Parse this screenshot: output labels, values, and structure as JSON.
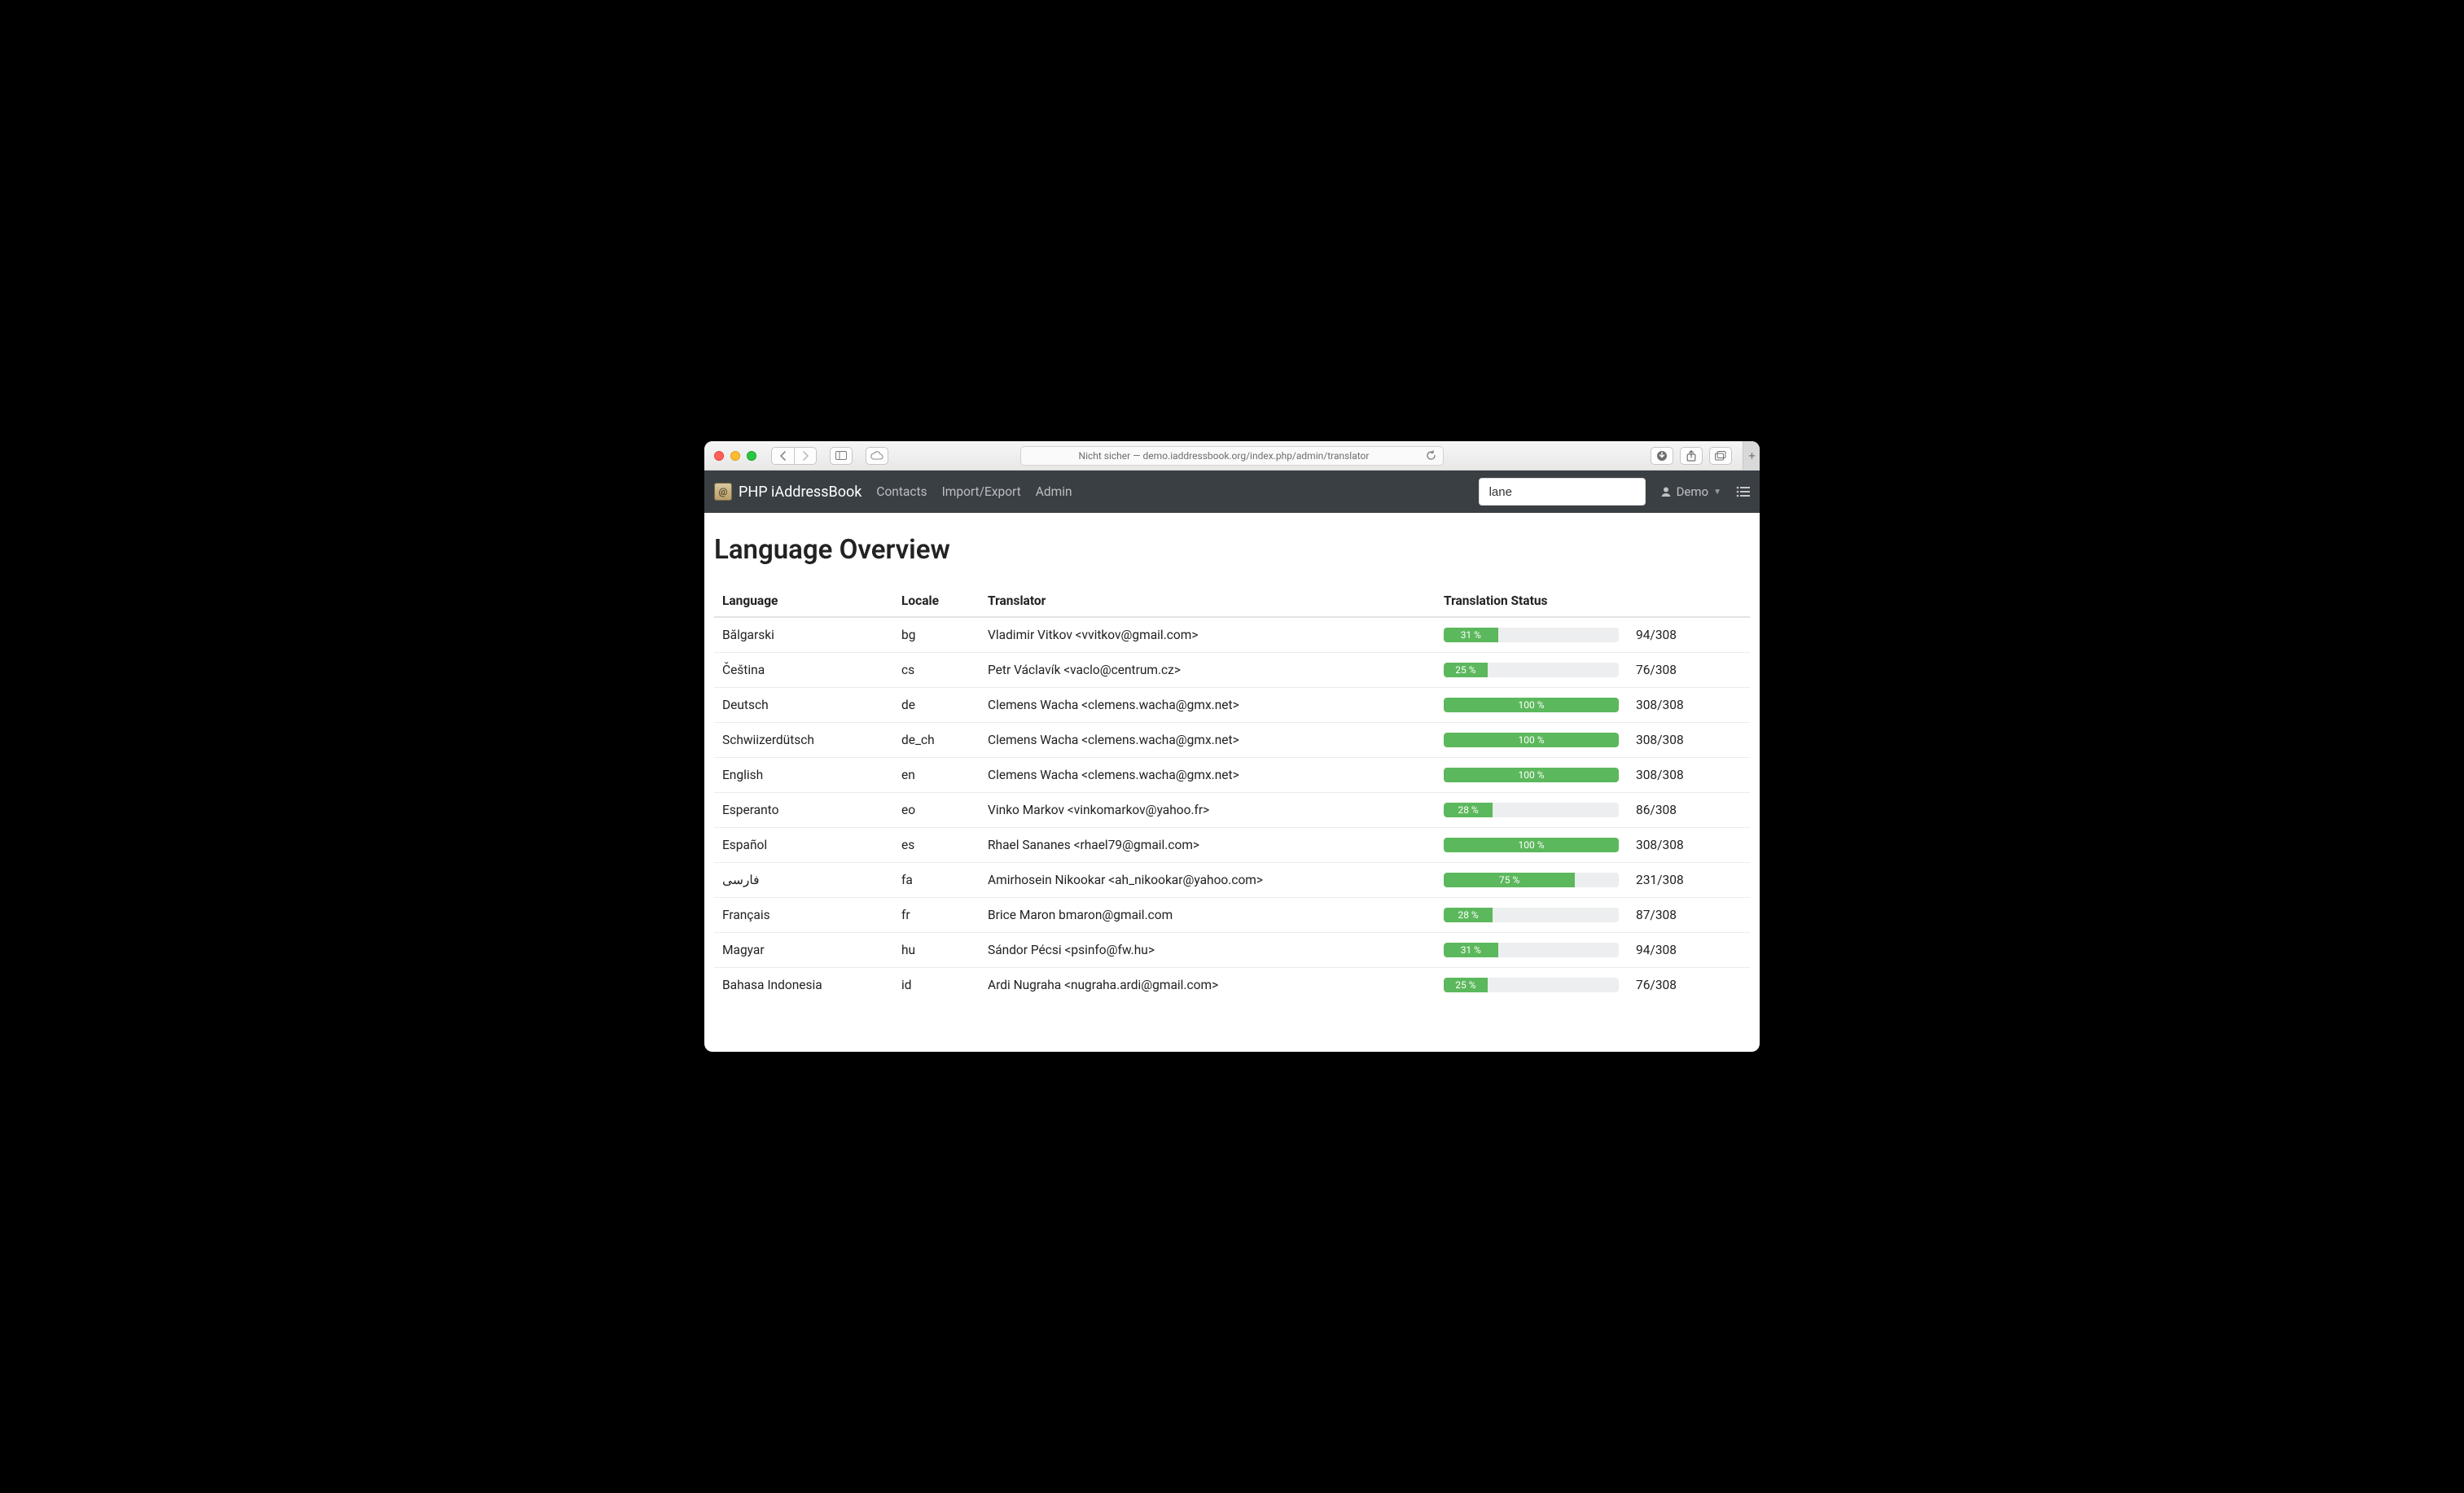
{
  "browser": {
    "address_label": "Nicht sicher — demo.iaddressbook.org/index.php/admin/translator"
  },
  "navbar": {
    "brand": "PHP iAddressBook",
    "links": {
      "contacts": "Contacts",
      "import_export": "Import/Export",
      "admin": "Admin"
    },
    "search_value": "lane",
    "user_label": "Demo"
  },
  "page": {
    "title": "Language Overview",
    "columns": {
      "language": "Language",
      "locale": "Locale",
      "translator": "Translator",
      "status": "Translation Status"
    }
  },
  "rows": [
    {
      "language": "Bălgarski",
      "locale": "bg",
      "translator": "Vladimir Vitkov <vvitkov@gmail.com>",
      "percent": 31,
      "done": 94,
      "total": 308
    },
    {
      "language": "Čeština",
      "locale": "cs",
      "translator": "Petr Václavík <vaclo@centrum.cz>",
      "percent": 25,
      "done": 76,
      "total": 308
    },
    {
      "language": "Deutsch",
      "locale": "de",
      "translator": "Clemens Wacha <clemens.wacha@gmx.net>",
      "percent": 100,
      "done": 308,
      "total": 308
    },
    {
      "language": "Schwiizerdütsch",
      "locale": "de_ch",
      "translator": "Clemens Wacha <clemens.wacha@gmx.net>",
      "percent": 100,
      "done": 308,
      "total": 308
    },
    {
      "language": "English",
      "locale": "en",
      "translator": "Clemens Wacha <clemens.wacha@gmx.net>",
      "percent": 100,
      "done": 308,
      "total": 308
    },
    {
      "language": "Esperanto",
      "locale": "eo",
      "translator": "Vinko Markov <vinkomarkov@yahoo.fr>",
      "percent": 28,
      "done": 86,
      "total": 308
    },
    {
      "language": "Español",
      "locale": "es",
      "translator": "Rhael Sananes <rhael79@gmail.com>",
      "percent": 100,
      "done": 308,
      "total": 308
    },
    {
      "language": "فارسی",
      "locale": "fa",
      "translator": "Amirhosein Nikookar <ah_nikookar@yahoo.com>",
      "percent": 75,
      "done": 231,
      "total": 308
    },
    {
      "language": "Français",
      "locale": "fr",
      "translator": "Brice Maron bmaron@gmail.com",
      "percent": 28,
      "done": 87,
      "total": 308
    },
    {
      "language": "Magyar",
      "locale": "hu",
      "translator": "Sándor Pécsi <psinfo@fw.hu>",
      "percent": 31,
      "done": 94,
      "total": 308
    },
    {
      "language": "Bahasa Indonesia",
      "locale": "id",
      "translator": "Ardi Nugraha <nugraha.ardi@gmail.com>",
      "percent": 25,
      "done": 76,
      "total": 308
    }
  ]
}
